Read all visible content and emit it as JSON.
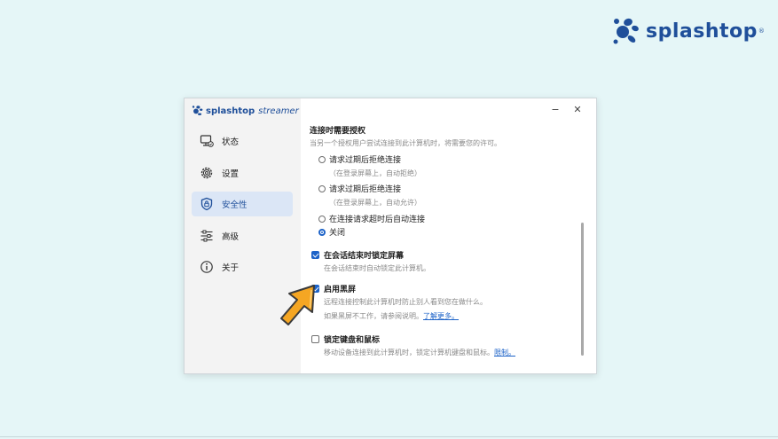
{
  "brand": {
    "name": "splashtop",
    "mark": "®",
    "color": "#1f4f9a"
  },
  "app": {
    "logo_name": "splashtop",
    "logo_product": "streamer"
  },
  "window": {
    "minimize": "−",
    "close": "✕"
  },
  "sidebar": {
    "items": [
      {
        "label": "状态",
        "icon": "monitor-status-icon"
      },
      {
        "label": "设置",
        "icon": "gear-icon"
      },
      {
        "label": "安全性",
        "icon": "shield-lock-icon",
        "active": true
      },
      {
        "label": "高级",
        "icon": "sliders-icon"
      },
      {
        "label": "关于",
        "icon": "info-icon"
      }
    ]
  },
  "content": {
    "auth": {
      "title": "连接时需要授权",
      "desc": "当另一个授权用户尝试连接到此计算机时，将需要您的许可。",
      "options": [
        {
          "label": "请求过期后拒绝连接",
          "hint": "（在登录屏幕上，自动拒绝）",
          "selected": false
        },
        {
          "label": "请求过期后拒绝连接",
          "hint": "（在登录屏幕上，自动允许）",
          "selected": false
        },
        {
          "label": "在连接请求超时后自动连接",
          "selected": false
        },
        {
          "label": "关闭",
          "selected": true
        }
      ]
    },
    "lock_screen": {
      "label": "在会话结束时锁定屏幕",
      "desc": "在会话结束时自动锁定此计算机。",
      "checked": true
    },
    "black_screen": {
      "label": "启用黑屏",
      "desc": "远程连接控制此计算机时防止别人看到您在做什么。",
      "help": "如果黑屏不工作，请参阅说明。",
      "help_link": "了解更多。",
      "checked": true
    },
    "lock_input": {
      "label": "锁定键盘和鼠标",
      "desc": "移动设备连接到此计算机时，锁定计算机键盘和鼠标。",
      "link": "限制。",
      "checked": false
    }
  },
  "colors": {
    "accent": "#1d63c8",
    "cursor": "#f5a623",
    "background": "#e5f6f7"
  }
}
